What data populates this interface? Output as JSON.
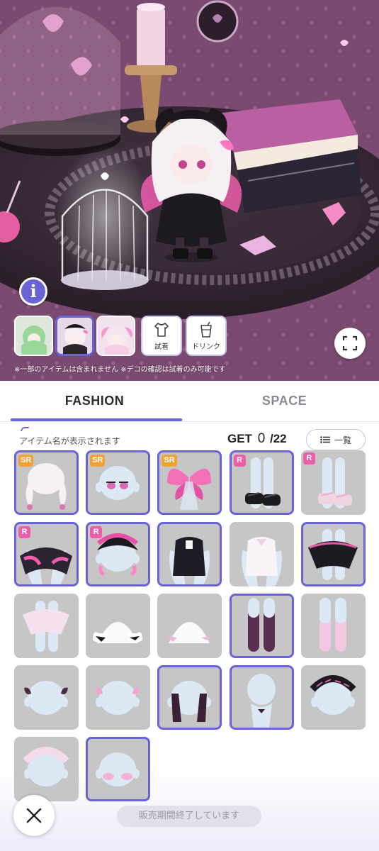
{
  "scene": {
    "info_icon": "info-icon",
    "thumbnails": [
      {
        "name": "avatar-green",
        "selected": false
      },
      {
        "name": "avatar-gothic",
        "selected": true
      },
      {
        "name": "avatar-pink",
        "selected": false
      }
    ],
    "try_on_label": "試着",
    "drink_label": "ドリンク",
    "fullscreen_icon": "fullscreen-icon",
    "notice": "※一部のアイテムは含まれません ※デコの確認は試着のみ可能です"
  },
  "tabs": [
    {
      "label": "FASHION",
      "active": true
    },
    {
      "label": "SPACE",
      "active": false
    }
  ],
  "panel": {
    "item_name_placeholder": "アイテム名が表示されます",
    "get_label": "GET",
    "get_count": "0",
    "get_total": "/22",
    "list_button_label": "一覧"
  },
  "items": [
    {
      "rarity": "SR",
      "kind": "hair-twin",
      "owned": true
    },
    {
      "rarity": "SR",
      "kind": "eyes",
      "owned": true
    },
    {
      "rarity": "SR",
      "kind": "wings",
      "owned": true
    },
    {
      "rarity": "R",
      "kind": "shoes-black",
      "owned": true
    },
    {
      "rarity": "R",
      "kind": "shoes-pink",
      "owned": false
    },
    {
      "rarity": "R",
      "kind": "cape",
      "owned": true
    },
    {
      "rarity": "R",
      "kind": "headdress",
      "owned": true
    },
    {
      "rarity": "",
      "kind": "top-black",
      "owned": true
    },
    {
      "rarity": "",
      "kind": "top-white",
      "owned": false
    },
    {
      "rarity": "",
      "kind": "skirt-black",
      "owned": true
    },
    {
      "rarity": "",
      "kind": "skirt-pink",
      "owned": false
    },
    {
      "rarity": "",
      "kind": "wrist-black",
      "owned": false
    },
    {
      "rarity": "",
      "kind": "wrist-pink",
      "owned": false
    },
    {
      "rarity": "",
      "kind": "socks-black",
      "owned": true
    },
    {
      "rarity": "",
      "kind": "socks-pink",
      "owned": false
    },
    {
      "rarity": "",
      "kind": "hairpin-black",
      "owned": false
    },
    {
      "rarity": "",
      "kind": "hairpin-pink",
      "owned": false
    },
    {
      "rarity": "",
      "kind": "gloves-black",
      "owned": true
    },
    {
      "rarity": "",
      "kind": "ribbon-back",
      "owned": true
    },
    {
      "rarity": "",
      "kind": "braid-black",
      "owned": false
    },
    {
      "rarity": "",
      "kind": "braid-pink",
      "owned": false
    },
    {
      "rarity": "",
      "kind": "blush",
      "owned": true
    }
  ],
  "footer": {
    "close_icon": "close-icon",
    "sale_ended": "販売期間終了しています"
  },
  "colors": {
    "accent": "#6a63d6",
    "sr_badge": "#f0a236",
    "r_badge": "#ee5ea8",
    "item_bg": "#c6c6c6"
  }
}
